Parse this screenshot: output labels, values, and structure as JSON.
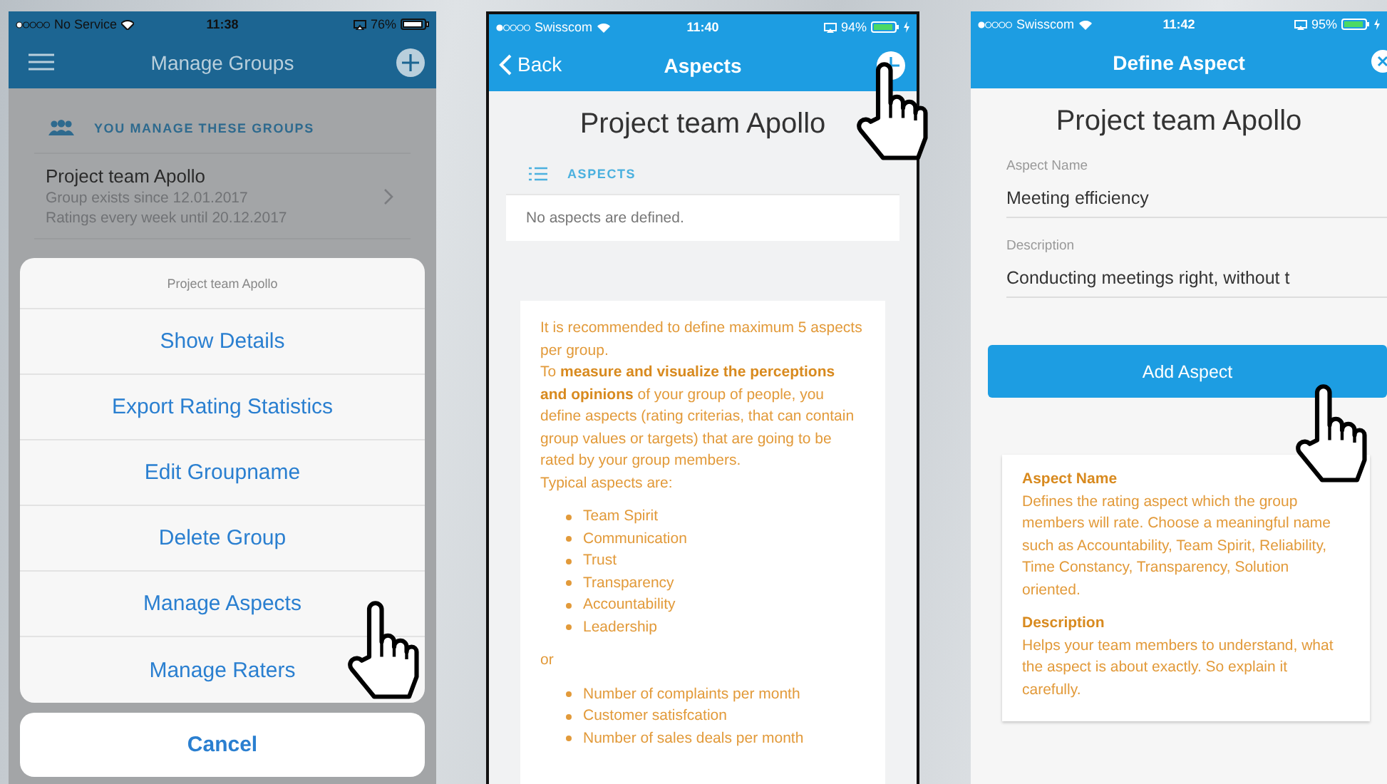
{
  "manage_groups_screen": {
    "status_bar": {
      "carrier": "No Service",
      "time": "11:38",
      "battery": "76%",
      "charging": false
    },
    "nav_title": "Manage Groups",
    "section_header": "YOU MANAGE THESE GROUPS",
    "group": {
      "name": "Project team Apollo",
      "lines": [
        "Group exists since 12.01.2017",
        "Ratings every week until 20.12.2017"
      ]
    },
    "action_sheet": {
      "title": "Project team Apollo",
      "items": [
        "Show Details",
        "Export Rating Statistics",
        "Edit Groupname",
        "Delete Group",
        "Manage Aspects",
        "Manage Raters"
      ],
      "cancel": "Cancel"
    }
  },
  "aspects_screen": {
    "status_bar": {
      "carrier": "Swisscom",
      "time": "11:40",
      "battery": "94%",
      "charging": true
    },
    "back": "Back",
    "nav_title": "Aspects",
    "group_title": "Project team Apollo",
    "section_header": "ASPECTS",
    "empty_message": "No aspects are defined.",
    "help": {
      "intro": "It is recommended to define maximum 5 aspects per group.",
      "paragraph": "To **measure and visualize the perceptions and opinions** of your group of people, you define aspects (rating criterias, that can contain group values or targets) that are going to be rated by your group members.",
      "lead": "Typical aspects are:",
      "examples": [
        "Team Spirit",
        "Communication",
        "Trust",
        "Transparency",
        "Accountability",
        "Leadership"
      ],
      "separator": "or",
      "metrics": [
        "Number of complaints per month",
        "Customer satisfcation",
        "Number of sales deals per month"
      ]
    }
  },
  "define_aspect_screen": {
    "status_bar": {
      "carrier": "Swisscom",
      "time": "11:42",
      "battery": "95%",
      "charging": true
    },
    "nav_title": "Define Aspect",
    "group_title": "Project team Apollo",
    "fields": [
      {
        "label": "Aspect Name",
        "value": "Meeting efficiency"
      },
      {
        "label": "Description",
        "value": "Conducting meetings right, without t"
      }
    ],
    "button": "Add Aspect",
    "help": [
      {
        "heading": "Aspect Name",
        "text": "Defines the rating aspect which the group members will rate. Choose a meaningful name such as Accountability, Team Spirit, Reliability, Time Constancy, Transparency, Solution oriented."
      },
      {
        "heading": "Description",
        "text": "Helps your team members to understand, what the aspect is about exactly. So explain it carefully."
      }
    ]
  }
}
